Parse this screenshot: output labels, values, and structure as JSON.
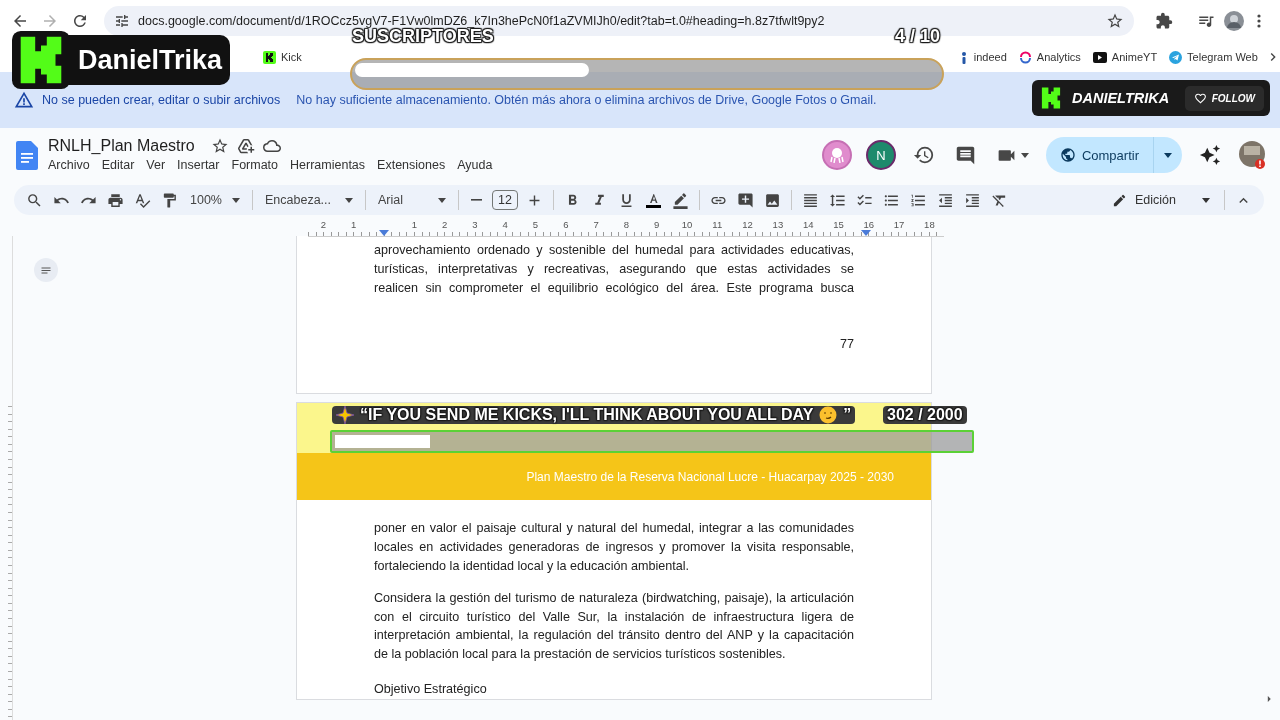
{
  "browser": {
    "url": "docs.google.com/document/d/1ROCcz5vgV7-F1Vw0lmDZ6_k7In3hePcN0f1aZVMIJh0/edit?tab=t.0#heading=h.8z7tfwlt9py2",
    "bookmarks": [
      {
        "label": "Kick",
        "kind": "kick"
      },
      {
        "label": "indeed",
        "kind": "indeed"
      },
      {
        "label": "Analytics",
        "kind": "analytics"
      },
      {
        "label": "AnimeYT",
        "kind": "video"
      },
      {
        "label": "Telegram Web",
        "kind": "telegram"
      }
    ]
  },
  "banner": {
    "title": "No se pueden crear, editar o subir archivos",
    "message": "No hay suficiente almacenamiento. Obtén más ahora o elimina archivos de Drive, Google Fotos o Gmail."
  },
  "document": {
    "title": "RNLH_Plan Maestro",
    "menu": [
      "Archivo",
      "Editar",
      "Ver",
      "Insertar",
      "Formato",
      "Herramientas",
      "Extensiones",
      "Ayuda"
    ],
    "avatar_initial": "N",
    "share_label": "Compartir"
  },
  "toolbar": {
    "zoom": "100%",
    "style": "Encabeza...",
    "font": "Arial",
    "font_size": "12",
    "mode": "Edición"
  },
  "ruler": [
    "2",
    "1",
    "1",
    "2",
    "3",
    "4",
    "5",
    "6",
    "7",
    "8",
    "9",
    "10",
    "11",
    "12",
    "13",
    "14",
    "15",
    "16",
    "17",
    "18"
  ],
  "pages": [
    {
      "paragraphs": [
        {
          "kind": "continued",
          "lines": [
            "aprovechamiento ordenado y sostenible del humedal para actividades educativas,",
            "turísticas, interpretativas y recreativas, asegurando que estas actividades se",
            "realicen sin comprometer el equilibrio ecológico del área. Este programa busca"
          ]
        }
      ],
      "page_number": "77"
    },
    {
      "header": "Plan Maestro de la Reserva Nacional Lucre - Huacarpay 2025 - 2030",
      "paragraphs": [
        {
          "kind": "text",
          "lines": [
            "poner en valor el paisaje cultural y natural del humedal, integrar a las comunidades",
            "locales en actividades generadoras de ingresos y promover la visita responsable,",
            "fortaleciendo la identidad local y la educación ambiental."
          ]
        },
        {
          "kind": "text",
          "lines": [
            "Considera la gestión del turismo de naturaleza (birdwatching, paisaje), la articulación",
            "con el circuito turístico del Valle Sur, la instalación de infraestructura ligera de",
            "interpretación ambiental, la regulación del tránsito dentro del ANP y la capacitación",
            "de la población local para la prestación de servicios turísticos sostenibles."
          ]
        },
        {
          "kind": "heading",
          "lines": [
            "Objetivo Estratégico"
          ]
        }
      ]
    }
  ],
  "overlay": {
    "channel_logo": "DanielTrika",
    "follow_name": "DANIELTRIKA",
    "follow_label": "FOLLOW",
    "subscriber_goal": {
      "label": "SUSCRIPTORES",
      "count": "4  / 10",
      "level": 0.4
    },
    "kicks_goal": {
      "slogan": "“IF YOU SEND ME KICKS, I'LL THINK ABOUT YOU ALL DAY",
      "closing": "”",
      "count": "302  / 2000",
      "level": 0.15
    }
  }
}
